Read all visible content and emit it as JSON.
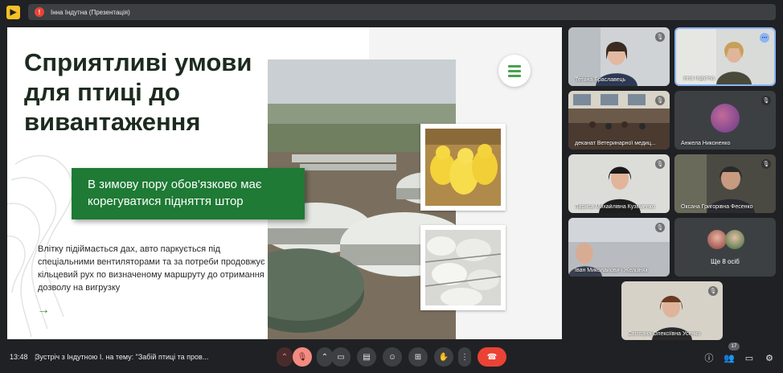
{
  "presentation_banner": {
    "label": "Інна Індутна (Презентація)",
    "badge_letter": "!"
  },
  "slide": {
    "title": "Сприятливі умови для птиці до вивантаження",
    "highlight": "В зимову пору обов'язково має корегуватися підняття штор",
    "body": "Влітку підіймається дах, авто паркується під спеціальними вентиляторами та за потреби продовжує кільцевий рух по визначеному маршруту до отримання дозволу на вигрузку",
    "arrow_glyph": "→",
    "accent_color": "#1e7a34"
  },
  "participants": [
    {
      "name": "Тетяна Браславець",
      "muted": true
    },
    {
      "name": "Інна Індутна",
      "muted": false,
      "active": true
    },
    {
      "name": "деканат Ветеринарної медиц...",
      "muted": true
    },
    {
      "name": "Анжела Никоненко",
      "muted": true
    },
    {
      "name": "Лариса Михайлівна Кузьменко",
      "muted": true
    },
    {
      "name": "Оксана Григорівна Фесенко",
      "muted": true
    },
    {
      "name": "Іван Миколайович Желізняк",
      "muted": true
    },
    {
      "name": "Світлана Олексіївна Усенко",
      "muted": true
    }
  ],
  "more_participants_label": "Ще 8 осіб",
  "bottom_bar": {
    "time": "13:48",
    "separator": "|",
    "meeting_title": "Зустріч з Індутною І. на тему: \"Забій птиці та пров...",
    "participant_count": "17"
  },
  "icons": {
    "mute": "🎙",
    "more": "⋯"
  }
}
